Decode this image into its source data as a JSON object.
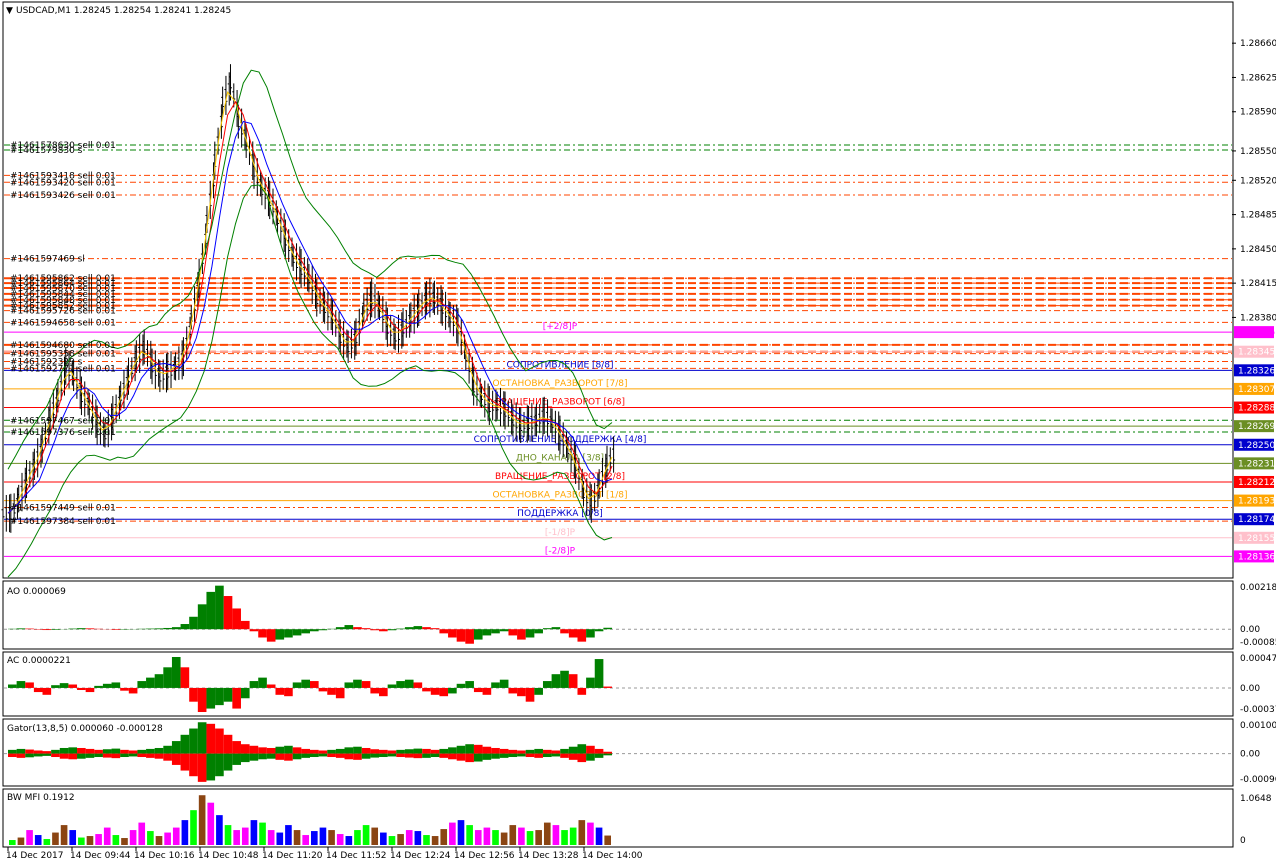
{
  "chart_data": [
    {
      "type": "candlestick",
      "title": "USDCAD,M1  1.28245 1.28254 1.28241 1.28245",
      "colors": {
        "candle": "#000000",
        "ma_fast": "#ff0000",
        "ma_mid": "#0000ff",
        "ma_slow": "#ffcc00",
        "bands": "#008000",
        "sell_line": "#ff4500",
        "green_line": "#008000"
      },
      "ylim": [
        1.28116,
        1.287
      ],
      "y_ticks": [
        1.2866,
        1.28625,
        1.2859,
        1.2855,
        1.2852,
        1.28485,
        1.2845,
        1.28415,
        1.2838
      ],
      "price_series": [
        1.2818,
        1.28195,
        1.28215,
        1.2823,
        1.2825,
        1.2828,
        1.283,
        1.2833,
        1.2832,
        1.283,
        1.2829,
        1.2827,
        1.2826,
        1.2828,
        1.283,
        1.2832,
        1.2834,
        1.2835,
        1.2833,
        1.2832,
        1.28325,
        1.2833,
        1.2834,
        1.2838,
        1.2842,
        1.2848,
        1.2854,
        1.286,
        1.2862,
        1.2858,
        1.2856,
        1.2853,
        1.2851,
        1.285,
        1.2848,
        1.2846,
        1.2844,
        1.2843,
        1.2842,
        1.284,
        1.2839,
        1.2838,
        1.2836,
        1.2835,
        1.2836,
        1.2839,
        1.284,
        1.2839,
        1.2837,
        1.2836,
        1.2837,
        1.2838,
        1.2839,
        1.284,
        1.284,
        1.2839,
        1.2838,
        1.2837,
        1.2834,
        1.2831,
        1.283,
        1.2829,
        1.2829,
        1.28285,
        1.28275,
        1.2827,
        1.28272,
        1.28275,
        1.2828,
        1.28272,
        1.2826,
        1.28245,
        1.2823,
        1.282,
        1.2819,
        1.2821,
        1.2823,
        1.28245
      ],
      "order_labels": [
        {
          "text": "#1461578630 sell 0.01",
          "price": 1.28556
        },
        {
          "text": "#1461579830 s",
          "price": 1.28551
        },
        {
          "text": "#1461593418 sell 0.01",
          "price": 1.28525
        },
        {
          "text": "#1461593420 sell 0.01",
          "price": 1.28518
        },
        {
          "text": "#1461593426 sell 0.01",
          "price": 1.28505
        },
        {
          "text": "#1461597469 sl",
          "price": 1.2844
        },
        {
          "text": "#1461595862 sell 0.01",
          "price": 1.2842
        },
        {
          "text": "#1461595864 sell 0.01",
          "price": 1.28415
        },
        {
          "text": "#1461595870 sell 0.01",
          "price": 1.2841
        },
        {
          "text": "#1461595844 sell 0.01",
          "price": 1.28404
        },
        {
          "text": "#1461595848 sell 0.01",
          "price": 1.28398
        },
        {
          "text": "#1461595852 sell 0.01",
          "price": 1.28392
        },
        {
          "text": "#1461595726 sell 0.01",
          "price": 1.28387
        },
        {
          "text": "#1461594658 sell 0.01",
          "price": 1.28375
        },
        {
          "text": "#1461594680 sell 0.01",
          "price": 1.28352
        },
        {
          "text": "#1461595358 sell 0.01",
          "price": 1.28343
        },
        {
          "text": "#1461592329 s",
          "price": 1.28335
        },
        {
          "text": "#1461592771 sell 0.01",
          "price": 1.28328
        },
        {
          "text": "#1461597467 sell 0.01",
          "price": 1.28275
        },
        {
          "text": "#1461597376 sell 0.01",
          "price": 1.28263
        },
        {
          "text": "#1461597449 sell 0.01",
          "price": 1.28186
        },
        {
          "text": "#1461597384 sell 0.01",
          "price": 1.28172
        }
      ],
      "murrey_levels": [
        {
          "label": "[+2/8]P",
          "value": "1.28365",
          "price": 1.28365,
          "color": "#ff00ff",
          "text_color": "#ff00ff"
        },
        {
          "label": "",
          "value": "1.28345",
          "price": 1.28345,
          "color": "#ffc0cb",
          "text_color": "#ffffff"
        },
        {
          "label": "СОПРОТИВЛЕНИЕ [8/8]",
          "value": "1.28326",
          "price": 1.28326,
          "color": "#0000cd",
          "text_color": "#ffffff"
        },
        {
          "label": "ОСТАНОВКА_РАЗВОРОТ [7/8]",
          "value": "1.28307",
          "price": 1.28307,
          "color": "#ffa500",
          "text_color": "#ffffff"
        },
        {
          "label": "ВРАЩЕНИЕ_РАЗВОРОТ [6/8]",
          "value": "1.28288",
          "price": 1.28288,
          "color": "#ff0000",
          "text_color": "#ffffff"
        },
        {
          "label": "",
          "value": "1.28269",
          "price": 1.28269,
          "color": "#6b8e23",
          "text_color": "#ffffff"
        },
        {
          "label": "СОПРОТИВЛЕНИЕ_ПОДДЕРЖКА [4/8]",
          "value": "1.28250",
          "price": 1.2825,
          "color": "#0000cd",
          "text_color": "#ffffff"
        },
        {
          "label": "ДНО_КАНАЛА [3/8]",
          "value": "1.28231",
          "price": 1.28231,
          "color": "#6b8e23",
          "text_color": "#ffffff"
        },
        {
          "label": "ВРАЩЕНИЕ_РАЗВОРОТ [2/8]",
          "value": "1.28212",
          "price": 1.28212,
          "color": "#ff0000",
          "text_color": "#ffffff"
        },
        {
          "label": "ОСТАНОВКА_РАЗВОРОТ [1/8]",
          "value": "1.28193",
          "price": 1.28193,
          "color": "#ffa500",
          "text_color": "#ffffff"
        },
        {
          "label": "ПОДДЕРЖКА [0/8]",
          "value": "1.28174",
          "price": 1.28174,
          "color": "#0000cd",
          "text_color": "#ffffff"
        },
        {
          "label": "[-1/8]P",
          "value": "1.28155",
          "price": 1.28155,
          "color": "#ffc0cb",
          "text_color": "#ffffff"
        },
        {
          "label": "[-2/8]P",
          "value": "1.28136",
          "price": 1.28136,
          "color": "#ff00ff",
          "text_color": "#ffffff"
        }
      ],
      "sell_lines": [
        1.2842,
        1.28415,
        1.2841,
        1.28404,
        1.28398,
        1.28392,
        1.28352,
        1.28345
      ]
    },
    {
      "type": "bar",
      "title": "AO 0.000069",
      "y_ticks": [
        "0.00218",
        "0.00",
        "-0.000858"
      ],
      "ylim": [
        -0.000858,
        0.00218
      ]
    },
    {
      "type": "bar",
      "title": "AC 0.0000221",
      "y_ticks": [
        "0.000479",
        "0.00",
        "-0.000379"
      ],
      "ylim": [
        -0.000379,
        0.000479
      ]
    },
    {
      "type": "bar",
      "title": "Gator(13,8,5) 0.000060 -0.000128",
      "y_ticks": [
        "0.001008",
        "0.00",
        "-0.000968"
      ],
      "ylim": [
        -0.000968,
        0.001008
      ]
    },
    {
      "type": "bar",
      "title": "BW MFI 0.1912",
      "y_ticks": [
        "1.0648",
        "0"
      ],
      "ylim": [
        0,
        1.0648
      ],
      "colors": {
        "green_up": "#00ff00",
        "blue": "#0000ff",
        "pink": "#ff00ff",
        "brown": "#8b4513"
      }
    }
  ],
  "x_axis": {
    "labels": [
      "14 Dec 2017",
      "14 Dec 09:44",
      "14 Dec 10:16",
      "14 Dec 10:48",
      "14 Dec 11:20",
      "14 Dec 11:52",
      "14 Dec 12:24",
      "14 Dec 12:56",
      "14 Dec 13:28",
      "14 Dec 14:00"
    ]
  },
  "oscillators": {
    "ao_values": [
      2e-05,
      4e-05,
      3e-05,
      -2e-05,
      -4e-05,
      -3e-05,
      1e-05,
      3e-05,
      5e-05,
      4e-05,
      2e-05,
      -1e-05,
      -3e-05,
      -2e-05,
      1e-05,
      2e-05,
      3e-05,
      4e-05,
      6e-05,
      0.0001,
      0.00025,
      0.0006,
      0.0012,
      0.0018,
      0.0021,
      0.0016,
      0.001,
      0.0004,
      -0.0001,
      -0.0004,
      -0.0006,
      -0.0005,
      -0.0004,
      -0.0003,
      -0.0002,
      -0.0001,
      -5e-05,
      2e-05,
      0.0001,
      0.0002,
      0.0001,
      5e-05,
      -5e-05,
      -0.0001,
      -5e-05,
      3e-05,
      0.0001,
      0.00015,
      0.0001,
      5e-05,
      -0.0002,
      -0.0004,
      -0.0006,
      -0.0007,
      -0.0005,
      -0.0003,
      -0.0002,
      -0.0001,
      -0.0003,
      -0.0005,
      -0.0004,
      -0.0002,
      5e-05,
      0.0001,
      -0.0002,
      -0.0004,
      -0.0006,
      -0.0004,
      -0.0001,
      7e-05
    ],
    "ac_values": [
      5e-05,
      0.0001,
      8e-05,
      -6e-05,
      -0.0001,
      4e-05,
      7e-05,
      5e-05,
      -3e-05,
      -6e-05,
      3e-05,
      6e-05,
      8e-05,
      -4e-05,
      -8e-05,
      0.0001,
      0.00015,
      0.0002,
      0.0003,
      0.00045,
      0.0003,
      -0.0002,
      -0.00035,
      -0.0003,
      -0.00025,
      -0.0002,
      -0.0003,
      -0.00015,
      0.0001,
      0.00015,
      5e-05,
      -0.0001,
      -0.00012,
      8e-05,
      0.00012,
      0.0001,
      -5e-05,
      -0.0001,
      -0.00015,
      8e-05,
      0.00012,
      0.0001,
      -8e-05,
      -0.00012,
      5e-05,
      0.0001,
      0.00012,
      8e-05,
      -5e-05,
      -0.0001,
      -0.00012,
      -8e-05,
      6e-05,
      0.0001,
      -6e-05,
      -0.0001,
      8e-05,
      0.00012,
      -8e-05,
      -0.00012,
      -0.0002,
      -0.0001,
      0.0001,
      0.0002,
      0.00025,
      0.0002,
      -0.0001,
      0.00015,
      0.00042,
      2e-05
    ],
    "gator_values": [
      0.00012,
      0.00015,
      0.00013,
      0.0001,
      8e-05,
      0.00012,
      0.00018,
      0.0002,
      0.00018,
      0.00015,
      0.00012,
      0.00014,
      0.00016,
      0.00012,
      0.0001,
      0.00012,
      0.00015,
      0.00018,
      0.00025,
      0.0004,
      0.0006,
      0.0008,
      0.001,
      0.00095,
      0.0008,
      0.0006,
      0.0004,
      0.0003,
      0.00025,
      0.0002,
      0.00018,
      0.00022,
      0.00025,
      0.0002,
      0.00015,
      0.00012,
      0.0001,
      0.00012,
      0.00015,
      0.0002,
      0.00022,
      0.00018,
      0.00014,
      0.00012,
      0.0001,
      0.00012,
      0.00014,
      0.00016,
      0.00015,
      0.00012,
      0.00015,
      0.0002,
      0.00025,
      0.0003,
      0.00028,
      0.00022,
      0.00018,
      0.00015,
      0.00012,
      0.0001,
      0.00012,
      0.00015,
      0.00012,
      0.0001,
      0.00015,
      0.00022,
      0.0003,
      0.00025,
      0.00015,
      6e-05
    ],
    "mfi_values": [
      0.1,
      0.15,
      0.3,
      0.2,
      0.12,
      0.25,
      0.4,
      0.3,
      0.15,
      0.18,
      0.22,
      0.35,
      0.2,
      0.14,
      0.3,
      0.45,
      0.28,
      0.18,
      0.25,
      0.35,
      0.5,
      0.7,
      1.0,
      0.85,
      0.6,
      0.4,
      0.3,
      0.35,
      0.5,
      0.45,
      0.3,
      0.25,
      0.4,
      0.3,
      0.2,
      0.28,
      0.35,
      0.3,
      0.22,
      0.18,
      0.3,
      0.4,
      0.35,
      0.25,
      0.18,
      0.22,
      0.3,
      0.28,
      0.2,
      0.18,
      0.32,
      0.45,
      0.5,
      0.4,
      0.3,
      0.35,
      0.3,
      0.25,
      0.4,
      0.35,
      0.28,
      0.3,
      0.45,
      0.4,
      0.3,
      0.35,
      0.5,
      0.45,
      0.35,
      0.19
    ]
  }
}
